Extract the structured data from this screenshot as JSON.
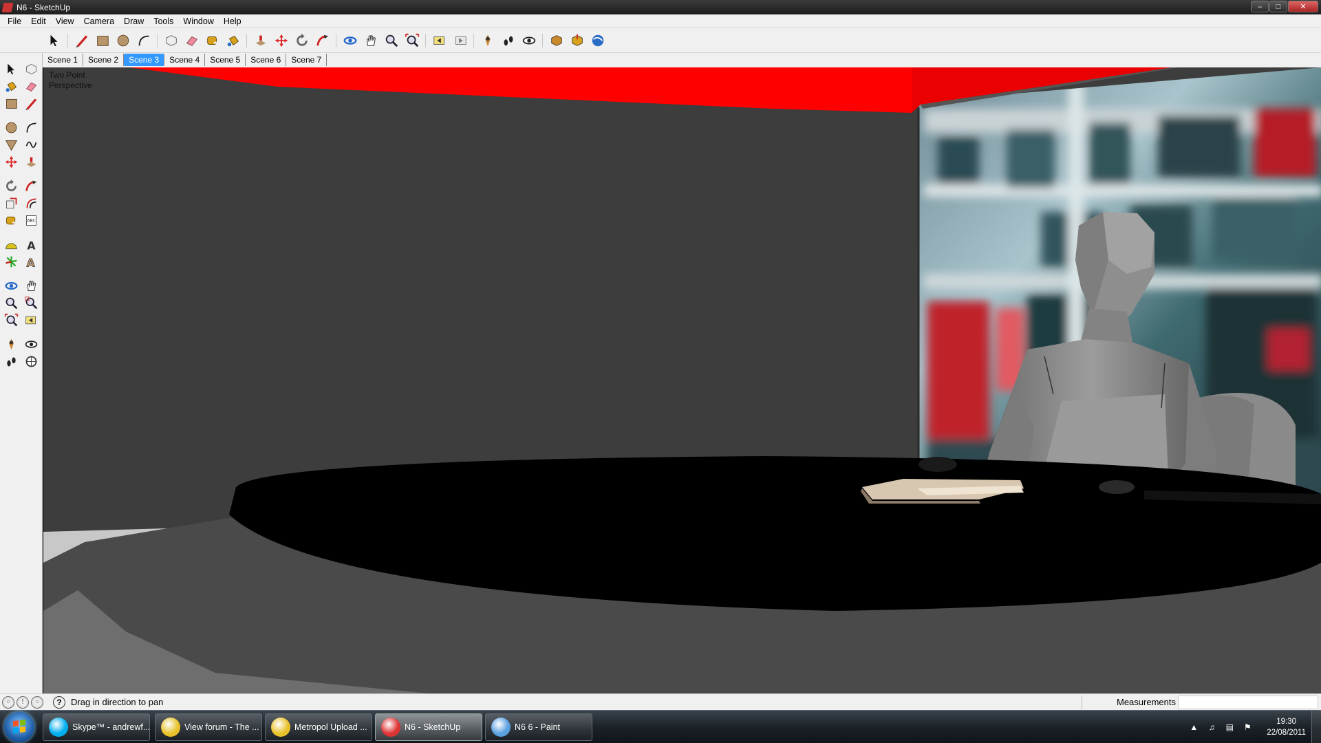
{
  "window": {
    "title": "N6 - SketchUp",
    "controls": [
      "minimize",
      "maximize",
      "close"
    ]
  },
  "menu": [
    "File",
    "Edit",
    "View",
    "Camera",
    "Draw",
    "Tools",
    "Window",
    "Help"
  ],
  "toolbar": {
    "tools": [
      "select-arrow-icon",
      "pencil-line-icon",
      "rectangle-icon",
      "circle-icon",
      "arc-icon",
      "make-component-icon",
      "eraser-icon",
      "tape-measure-icon",
      "paint-bucket-icon",
      "push-pull-icon",
      "move-icon",
      "rotate-icon",
      "follow-me-icon",
      "orbit-icon",
      "pan-hand-icon",
      "zoom-icon",
      "zoom-extents-icon",
      "previous-view-icon",
      "next-view-icon",
      "position-camera-icon",
      "walk-icon",
      "look-around-icon",
      "get-models-icon",
      "share-model-icon",
      "google-earth-icon"
    ]
  },
  "scenes": {
    "tabs": [
      "Scene 1",
      "Scene 2",
      "Scene 3",
      "Scene 4",
      "Scene 5",
      "Scene 6",
      "Scene 7"
    ],
    "active_index": 2
  },
  "palette": {
    "tools": [
      "select-icon",
      "make-component-icon",
      "paint-bucket-icon",
      "eraser-icon",
      "rectangle-icon",
      "line-icon",
      "circle-icon",
      "arc-icon",
      "polygon-icon",
      "freehand-icon",
      "move-icon",
      "push-pull-icon",
      "rotate-icon",
      "follow-me-icon",
      "scale-icon",
      "offset-icon",
      "tape-measure-icon",
      "dimension-icon",
      "protractor-icon",
      "text-icon",
      "axes-icon",
      "3d-text-icon",
      "orbit-icon",
      "pan-icon",
      "zoom-icon",
      "zoom-window-icon",
      "zoom-extents-icon",
      "previous-view-icon",
      "position-camera-icon",
      "look-around-icon",
      "walk-icon",
      "section-plane-icon"
    ]
  },
  "viewport": {
    "camera_label_line1": "Two Point",
    "camera_label_line2": "Perspective",
    "colors": {
      "wall": "#3d3d3d",
      "ceiling_red": "#ff0000",
      "floor_grey": "#a8a8a8",
      "desk_black": "#000000",
      "desk_edge": "#4a4a4a",
      "figure_grey": "#8f8f8f"
    }
  },
  "statusbar": {
    "status_text": "Drag in direction to pan",
    "measurements_label": "Measurements",
    "measurements_value": ""
  },
  "taskbar": {
    "items": [
      {
        "label": "Skype™ - andrewf...",
        "icon": "skype-icon",
        "color": "#00aff0"
      },
      {
        "label": "View forum - The ...",
        "icon": "chrome-icon",
        "color": "#e8c22a"
      },
      {
        "label": "Metropol Upload ...",
        "icon": "chrome-icon",
        "color": "#e8c22a"
      },
      {
        "label": "N6 - SketchUp",
        "icon": "sketchup-icon",
        "color": "#d33"
      },
      {
        "label": "N6 6 - Paint",
        "icon": "paint-icon",
        "color": "#5aa0e0"
      }
    ],
    "active_index": 3,
    "time": "19:30",
    "date": "22/08/2011"
  }
}
